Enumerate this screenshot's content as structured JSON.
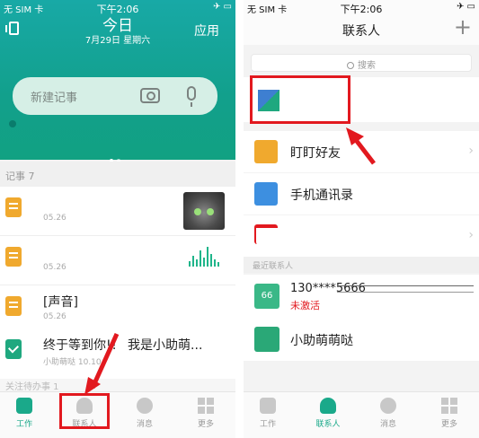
{
  "left": {
    "status": {
      "carrier": "无 SIM 卡 ",
      "time": "下午2:06",
      "right": "✈ ▭"
    },
    "header": {
      "title": "今日",
      "date": "7月29日 星期六",
      "action": "应用"
    },
    "note_input": {
      "placeholder": "新建记事"
    },
    "section_label": "记事 7",
    "notes": [
      {
        "title": "",
        "date": "05.26"
      },
      {
        "title": "",
        "date": "05.26"
      },
      {
        "title": "[声音]",
        "date": "05.26"
      },
      {
        "title": "终于等到你!！ 我是小助萌...",
        "date": "小助萌哒  10.10"
      }
    ],
    "partial_label": "关注待办事 1",
    "tabs": [
      "工作",
      "联系人",
      "消息",
      "更多"
    ]
  },
  "right": {
    "status": {
      "carrier": "无 SIM 卡 ",
      "time": "下午2:06",
      "right": "✈ ▭"
    },
    "title": "联系人",
    "plus": "+",
    "search_placeholder": "搜索",
    "items": [
      {
        "label": "盯盯好友",
        "color": "#f0a92e"
      },
      {
        "label": "手机通讯录",
        "color": "#3d8fe0"
      },
      {
        "label": "",
        "color": "#e2191f"
      }
    ],
    "recent_label": "最近联系人",
    "contacts": [
      {
        "avatar": "66",
        "name": "130****5666",
        "status": "未激活"
      },
      {
        "avatar": "",
        "name": "小助萌萌哒",
        "status": ""
      }
    ],
    "tabs": [
      "工作",
      "联系人",
      "消息",
      "更多"
    ],
    "chevron": "›"
  },
  "colors": {
    "accent": "#1aa98a",
    "highlight": "#e2191f"
  }
}
